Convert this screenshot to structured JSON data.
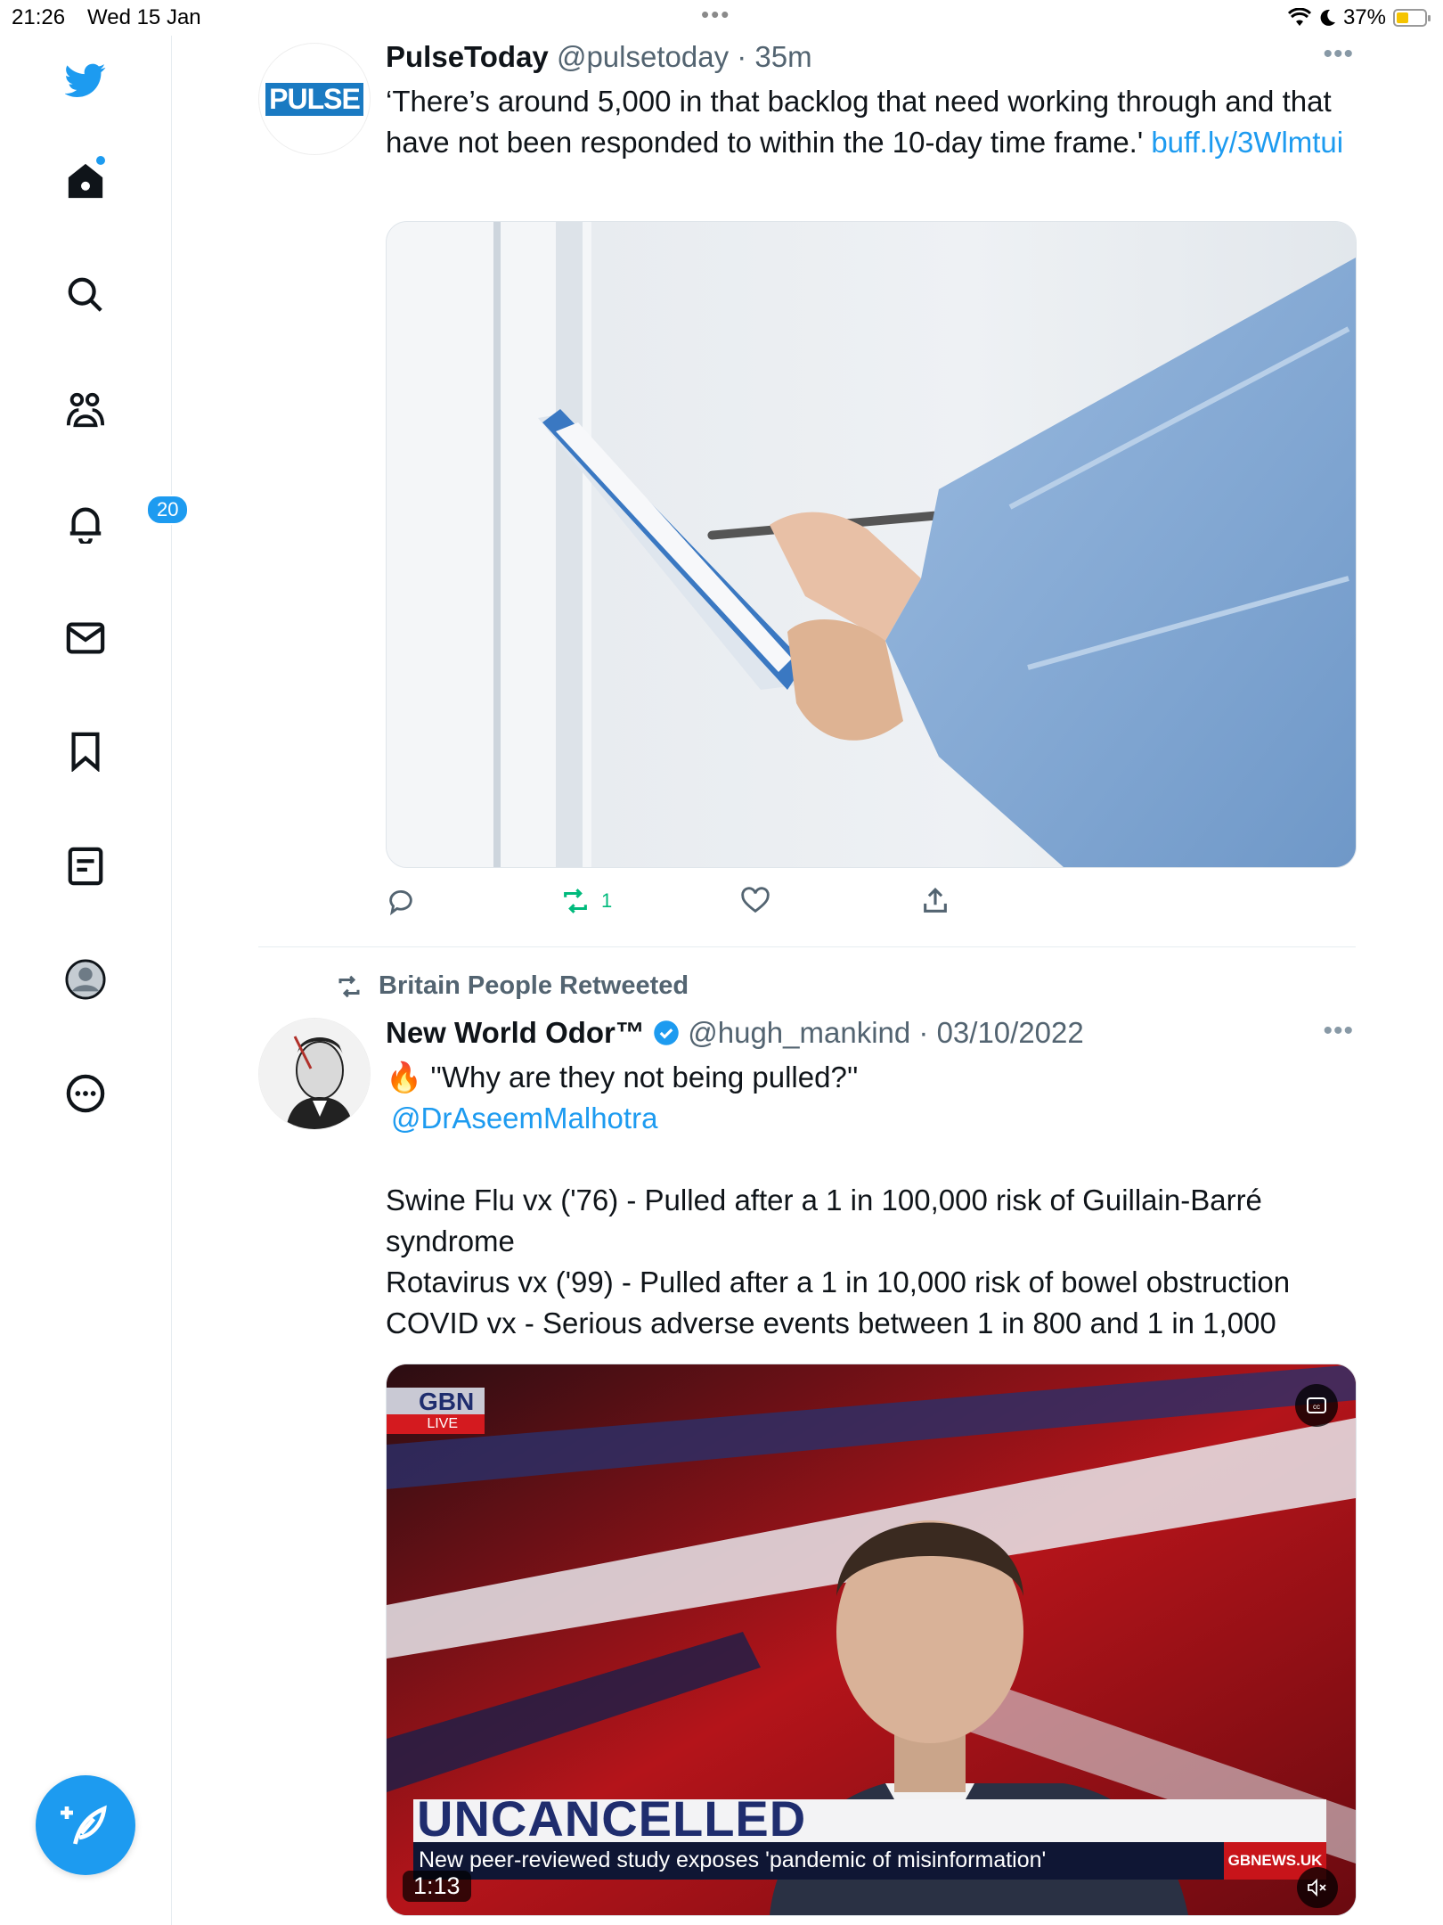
{
  "status_bar": {
    "time": "21:26",
    "date": "Wed 15 Jan",
    "battery": "37%",
    "battery_level": 0.37
  },
  "sidebar": {
    "notifications_badge": "20"
  },
  "tweets": [
    {
      "display_name": "PulseToday",
      "handle": "@pulsetoday",
      "time": "35m",
      "avatar_text": "PULSE",
      "text": "‘There’s around 5,000 in that backlog that need working through and that have not been responded to within the 10-day time frame.'",
      "link": "buff.ly/3Wlmtui",
      "retweet_count": "1"
    },
    {
      "retweeted_by": "Britain People Retweeted",
      "display_name": "New World Odor™",
      "handle": "@hugh_mankind",
      "time": "03/10/2022",
      "line1": "''Why are they not being pulled?''",
      "mention": "@DrAseemMalhotra",
      "body": [
        "Swine Flu vx ('76) - Pulled after a 1 in 100,000 risk of Guillain-Barré syndrome",
        "Rotavirus vx ('99) - Pulled after a 1 in 10,000 risk of bowel obstruction",
        "COVID vx -  Serious adverse events between 1 in 800 and 1 in 1,000"
      ],
      "video": {
        "channel_logo": "GBN",
        "live_label": "LIVE",
        "banner_title": "UNCANCELLED",
        "ticker": "New peer-reviewed study exposes 'pandemic of misinformation'",
        "site": "GBNEWS.UK",
        "duration": "1:13"
      }
    }
  ]
}
